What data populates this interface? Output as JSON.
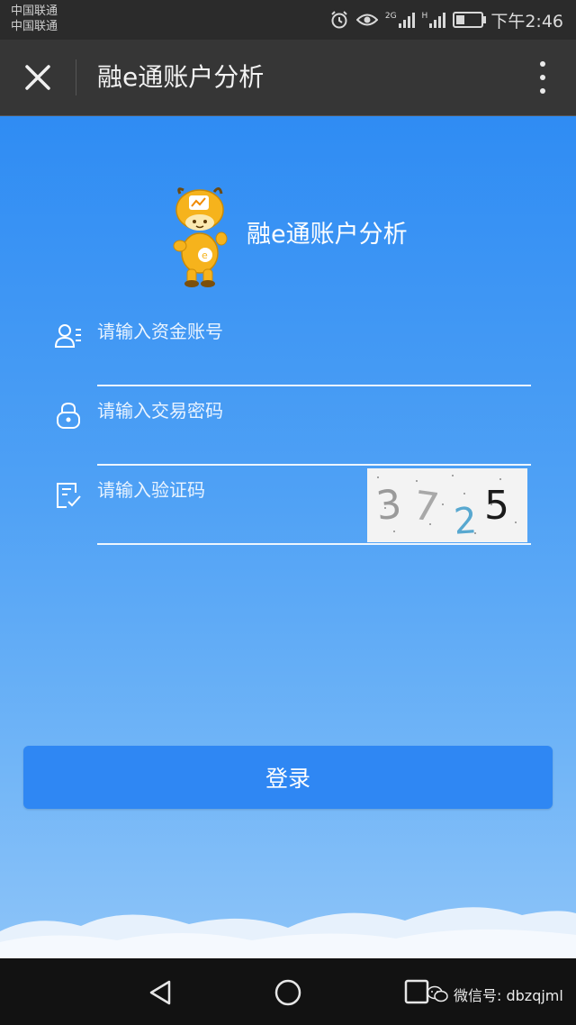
{
  "status_bar": {
    "carrier_1": "中国联通",
    "carrier_2": "中国联通",
    "network_1": "2G",
    "network_2": "H",
    "time": "下午2:46",
    "battery_level": 0.35,
    "icons": [
      "alarm-icon",
      "eye-icon",
      "signal-icon",
      "signal-icon",
      "battery-icon"
    ]
  },
  "title_bar": {
    "title": "融e通账户分析",
    "icons": [
      "close-icon",
      "more-vertical-icon"
    ]
  },
  "header": {
    "brand_name": "融e通账户分析"
  },
  "form": {
    "account_placeholder": "请输入资金账号",
    "password_placeholder": "请输入交易密码",
    "captcha_placeholder": "请输入验证码",
    "captcha_digits": [
      "3",
      "7",
      "2",
      "5"
    ],
    "captcha_colors": [
      "#9a9a9a",
      "#a8a8a8",
      "#58a8d0",
      "#1a1a1a"
    ],
    "icons": [
      "user-list-icon",
      "lock-icon",
      "checklist-icon"
    ]
  },
  "login_button": {
    "label": "登录",
    "color": "#2f87f3"
  },
  "nav_bar": {
    "icons": [
      "back-icon",
      "home-icon",
      "recent-apps-icon"
    ]
  },
  "watermark": {
    "text": "微信号: dbzqjml"
  },
  "colors": {
    "background_top": "#2f8cf3",
    "background_bottom": "#8dc4f8",
    "titlebar": "#363636",
    "statusbar": "#2b2b2b"
  }
}
